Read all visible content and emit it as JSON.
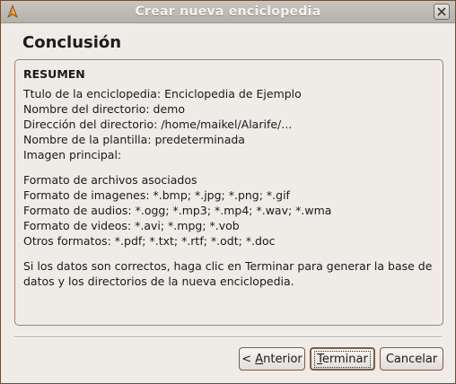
{
  "window": {
    "title": "Crear nueva enciclopedia"
  },
  "page": {
    "heading": "Conclusión"
  },
  "summary": {
    "title": "RESUMEN",
    "lines": [
      "Ttulo de la enciclopedia: Enciclopedia de Ejemplo",
      "Nombre del directorio: demo",
      "Dirección del directorio: /home/maikel/Alarife/...",
      "Nombre de la plantilla: predeterminada",
      "Imagen principal:"
    ],
    "formats": [
      "Formato de archivos asociados",
      "Formato de imagenes: *.bmp; *.jpg; *.png; *.gif",
      "Formato de audios: *.ogg; *.mp3; *.mp4; *.wav; *.wma",
      "Formato de videos: *.avi; *.mpg; *.vob",
      "Otros formatos: *.pdf; *.txt; *.rtf; *.odt; *.doc"
    ],
    "message": "Si los datos son correctos, haga clic en Terminar para generar la base de datos y los directorios de la nueva enciclopedia."
  },
  "buttons": {
    "prev": {
      "prefix": "< ",
      "mnemonic": "A",
      "rest": "nterior"
    },
    "finish": {
      "mnemonic": "T",
      "rest": "erminar"
    },
    "cancel": "Cancelar"
  },
  "icons": {
    "app": "app-logo-icon",
    "close": "close-icon"
  }
}
